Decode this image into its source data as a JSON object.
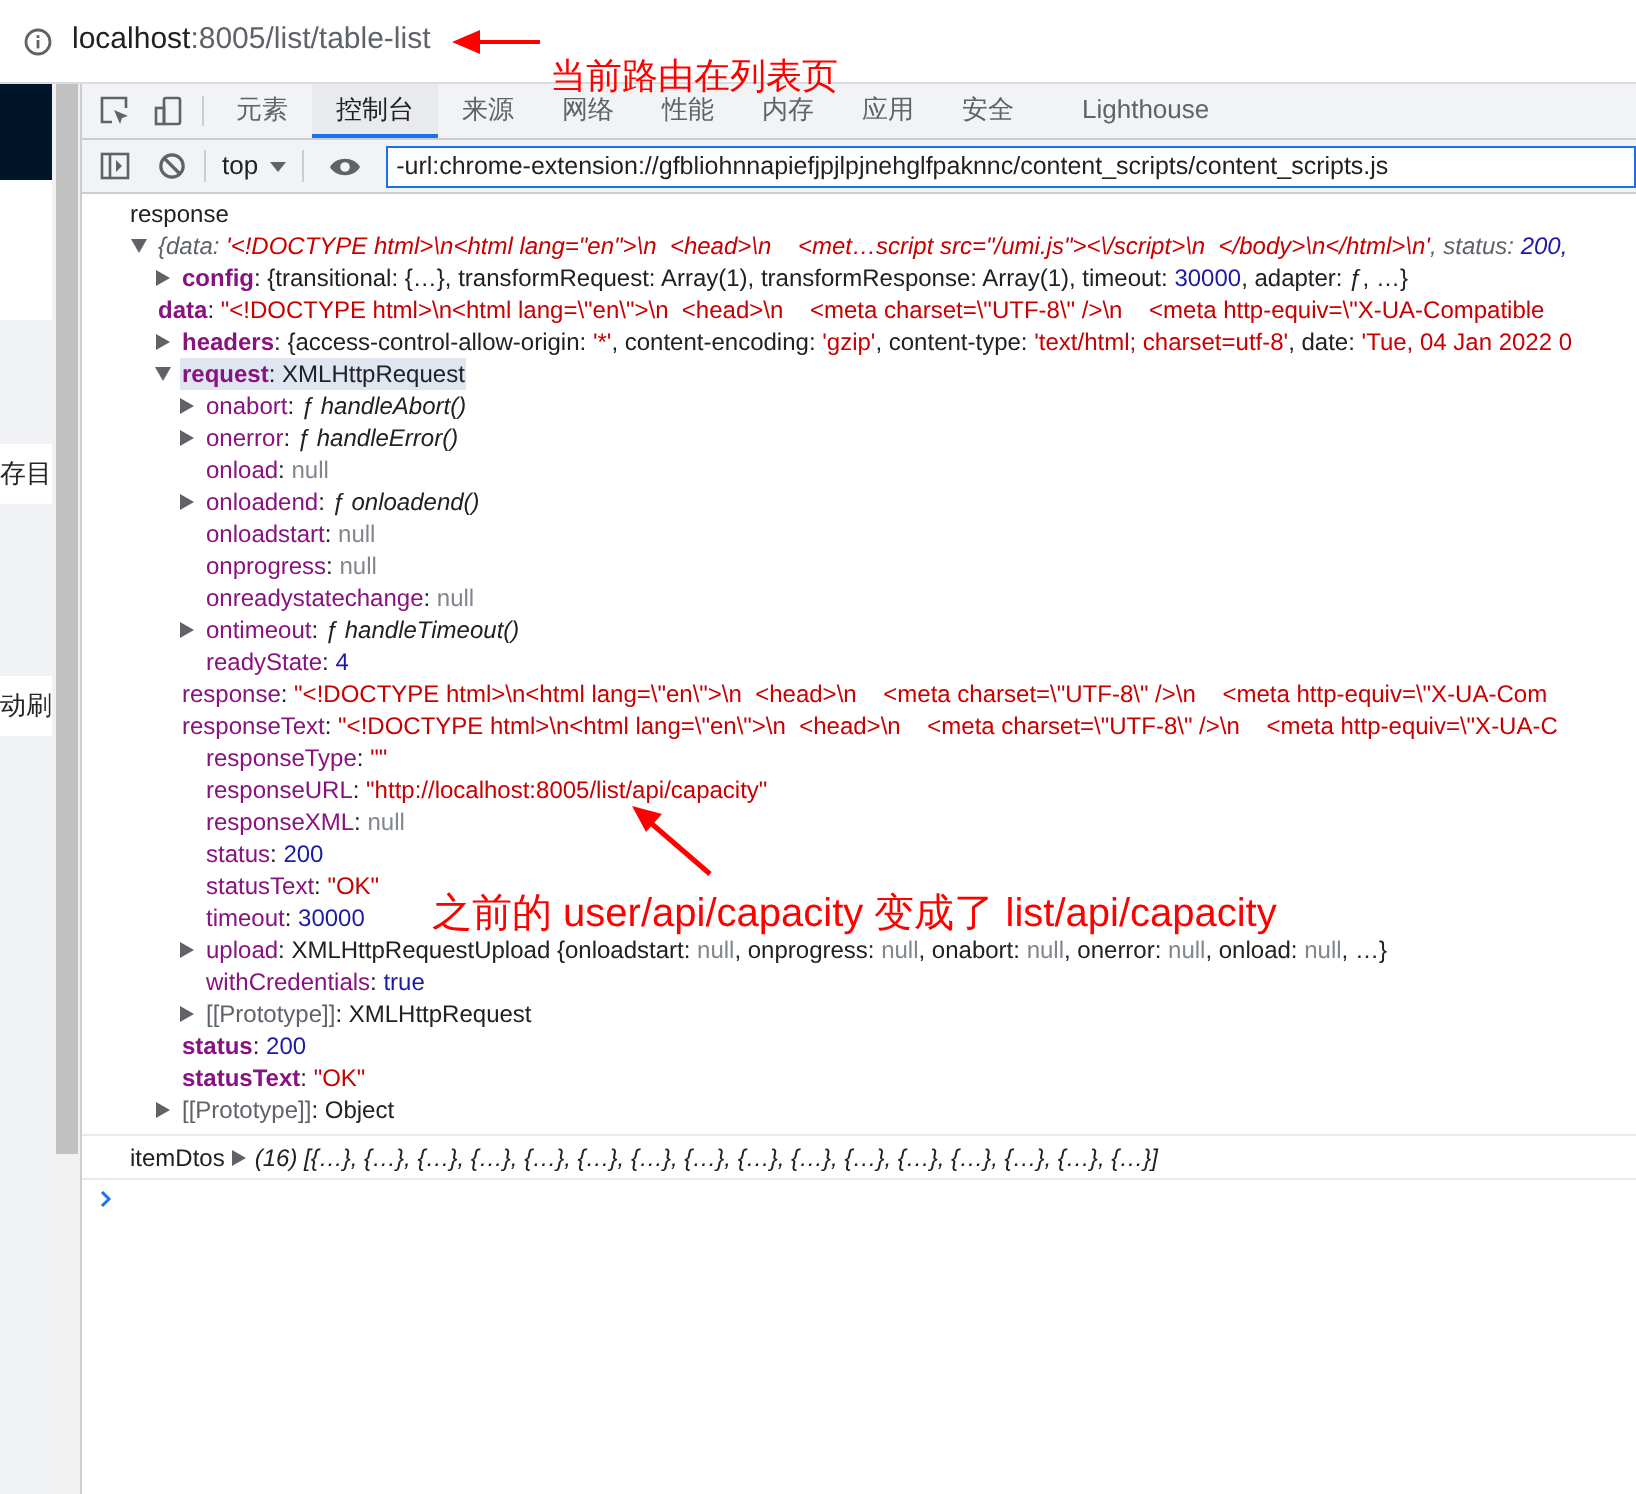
{
  "address_bar": {
    "host": "localhost",
    "path": ":8005/list/table-list"
  },
  "annotations": [
    {
      "kind": "url",
      "text": "当前路由在列表页"
    },
    {
      "kind": "response_url",
      "text": "之前的 user/api/capacity 变成了 list/api/capacity"
    }
  ],
  "page_strip": {
    "buttons": [
      "存目",
      "动刷"
    ]
  },
  "devtools": {
    "tabs": [
      {
        "label": "元素",
        "selected": false
      },
      {
        "label": "控制台",
        "selected": true
      },
      {
        "label": "来源",
        "selected": false
      },
      {
        "label": "网络",
        "selected": false
      },
      {
        "label": "性能",
        "selected": false
      },
      {
        "label": "内存",
        "selected": false
      },
      {
        "label": "应用",
        "selected": false
      },
      {
        "label": "安全",
        "selected": false
      },
      {
        "label": "Lighthouse",
        "selected": false
      }
    ],
    "context": "top",
    "filter": "-url:chrome-extension://gfbliohnnapiefjpjlpjnehglfpaknnc/content_scripts/content_scripts.js"
  },
  "console": {
    "label": "response",
    "separator": ": ",
    "root": {
      "kind": "expandable",
      "expanded": true,
      "italic": true,
      "selected": false,
      "value": [
        {
          "kind": "dim",
          "text": "{data: "
        },
        {
          "kind": "str",
          "text": "'<!DOCTYPE html>\\n<html lang=\"en\">\\n  <head>\\n    <met…script src=\"/umi.js\"><\\/script>\\n  </body>\\n</html>\\n'"
        },
        {
          "kind": "dim",
          "text": ", status: "
        },
        {
          "kind": "num",
          "text": "200,"
        }
      ],
      "children": [
        {
          "key": "config",
          "kind": "expandable",
          "expanded": false,
          "bold": true,
          "selected": false,
          "value": [
            {
              "kind": "text",
              "text": "{transitional: {…}, transformRequest: Array(1), transformResponse: Array(1), timeout: "
            },
            {
              "kind": "num",
              "text": "30000"
            },
            {
              "kind": "text",
              "text": ", adapter: ƒ, …}"
            }
          ]
        },
        {
          "key": "data",
          "kind": "flat",
          "bold": true,
          "selected": false,
          "value": [
            {
              "kind": "str",
              "text": "\"<!DOCTYPE html>\\n<html lang=\\\"en\\\">\\n  <head>\\n    <meta charset=\\\"UTF-8\\\" />\\n    <meta http-equiv=\\\"X-UA-Compatible"
            }
          ]
        },
        {
          "key": "headers",
          "kind": "expandable",
          "expanded": false,
          "bold": true,
          "selected": false,
          "value": [
            {
              "kind": "text",
              "text": "{access-control-allow-origin: "
            },
            {
              "kind": "str",
              "text": "'*'"
            },
            {
              "kind": "text",
              "text": ", content-encoding: "
            },
            {
              "kind": "str",
              "text": "'gzip'"
            },
            {
              "kind": "text",
              "text": ", content-type: "
            },
            {
              "kind": "str",
              "text": "'text/html; charset=utf-8'"
            },
            {
              "kind": "text",
              "text": ", date: "
            },
            {
              "kind": "str",
              "text": "'Tue, 04 Jan 2022 0"
            }
          ]
        },
        {
          "key": "request",
          "kind": "expandable",
          "expanded": true,
          "bold": true,
          "selected": true,
          "value": [
            {
              "kind": "text",
              "text": "XMLHttpRequest"
            }
          ],
          "children": [
            {
              "key": "onabort",
              "kind": "expandable",
              "expanded": false,
              "bold": false,
              "selected": false,
              "value": [
                {
                  "kind": "func",
                  "text": "ƒ handleAbort()"
                }
              ]
            },
            {
              "key": "onerror",
              "kind": "expandable",
              "expanded": false,
              "bold": false,
              "selected": false,
              "value": [
                {
                  "kind": "func",
                  "text": "ƒ handleError()"
                }
              ]
            },
            {
              "key": "onload",
              "kind": "leaf",
              "bold": false,
              "selected": false,
              "value": [
                {
                  "kind": "null",
                  "text": "null"
                }
              ]
            },
            {
              "key": "onloadend",
              "kind": "expandable",
              "expanded": false,
              "bold": false,
              "selected": false,
              "value": [
                {
                  "kind": "func",
                  "text": "ƒ onloadend()"
                }
              ]
            },
            {
              "key": "onloadstart",
              "kind": "leaf",
              "bold": false,
              "selected": false,
              "value": [
                {
                  "kind": "null",
                  "text": "null"
                }
              ]
            },
            {
              "key": "onprogress",
              "kind": "leaf",
              "bold": false,
              "selected": false,
              "value": [
                {
                  "kind": "null",
                  "text": "null"
                }
              ]
            },
            {
              "key": "onreadystatechange",
              "kind": "leaf",
              "bold": false,
              "selected": false,
              "value": [
                {
                  "kind": "null",
                  "text": "null"
                }
              ]
            },
            {
              "key": "ontimeout",
              "kind": "expandable",
              "expanded": false,
              "bold": false,
              "selected": false,
              "value": [
                {
                  "kind": "func",
                  "text": "ƒ handleTimeout()"
                }
              ]
            },
            {
              "key": "readyState",
              "kind": "leaf",
              "bold": false,
              "selected": false,
              "value": [
                {
                  "kind": "num",
                  "text": "4"
                }
              ]
            },
            {
              "key": "response",
              "kind": "flat",
              "bold": false,
              "selected": false,
              "value": [
                {
                  "kind": "str",
                  "text": "\"<!DOCTYPE html>\\n<html lang=\\\"en\\\">\\n  <head>\\n    <meta charset=\\\"UTF-8\\\" />\\n    <meta http-equiv=\\\"X-UA-Com"
                }
              ]
            },
            {
              "key": "responseText",
              "kind": "flat",
              "bold": false,
              "selected": false,
              "value": [
                {
                  "kind": "str",
                  "text": "\"<!DOCTYPE html>\\n<html lang=\\\"en\\\">\\n  <head>\\n    <meta charset=\\\"UTF-8\\\" />\\n    <meta http-equiv=\\\"X-UA-C"
                }
              ]
            },
            {
              "key": "responseType",
              "kind": "leaf",
              "bold": false,
              "selected": false,
              "value": [
                {
                  "kind": "str",
                  "text": "\"\""
                }
              ]
            },
            {
              "key": "responseURL",
              "kind": "leaf",
              "bold": false,
              "selected": false,
              "value": [
                {
                  "kind": "str",
                  "text": "\"http://localhost:8005/list/api/capacity\""
                }
              ]
            },
            {
              "key": "responseXML",
              "kind": "leaf",
              "bold": false,
              "selected": false,
              "value": [
                {
                  "kind": "null",
                  "text": "null"
                }
              ]
            },
            {
              "key": "status",
              "kind": "leaf",
              "bold": false,
              "selected": false,
              "value": [
                {
                  "kind": "num",
                  "text": "200"
                }
              ]
            },
            {
              "key": "statusText",
              "kind": "leaf",
              "bold": false,
              "selected": false,
              "value": [
                {
                  "kind": "str",
                  "text": "\"OK\""
                }
              ]
            },
            {
              "key": "timeout",
              "kind": "leaf",
              "bold": false,
              "selected": false,
              "value": [
                {
                  "kind": "num",
                  "text": "30000"
                }
              ]
            },
            {
              "key": "upload",
              "kind": "expandable",
              "expanded": false,
              "bold": false,
              "selected": false,
              "value": [
                {
                  "kind": "text",
                  "text": "XMLHttpRequestUpload {onloadstart: "
                },
                {
                  "kind": "null",
                  "text": "null"
                },
                {
                  "kind": "text",
                  "text": ", onprogress: "
                },
                {
                  "kind": "null",
                  "text": "null"
                },
                {
                  "kind": "text",
                  "text": ", onabort: "
                },
                {
                  "kind": "null",
                  "text": "null"
                },
                {
                  "kind": "text",
                  "text": ", onerror: "
                },
                {
                  "kind": "null",
                  "text": "null"
                },
                {
                  "kind": "text",
                  "text": ", onload: "
                },
                {
                  "kind": "null",
                  "text": "null"
                },
                {
                  "kind": "text",
                  "text": ", …}"
                }
              ]
            },
            {
              "key": "withCredentials",
              "kind": "leaf",
              "bold": false,
              "selected": false,
              "value": [
                {
                  "kind": "num",
                  "text": "true"
                }
              ]
            },
            {
              "key": "[[Prototype]]",
              "internal": true,
              "kind": "expandable",
              "expanded": false,
              "bold": false,
              "selected": false,
              "value": [
                {
                  "kind": "text",
                  "text": "XMLHttpRequest"
                }
              ]
            }
          ]
        },
        {
          "key": "status",
          "kind": "leaf",
          "bold": true,
          "selected": false,
          "value": [
            {
              "kind": "num",
              "text": "200"
            }
          ]
        },
        {
          "key": "statusText",
          "kind": "leaf",
          "bold": true,
          "selected": false,
          "value": [
            {
              "kind": "str",
              "text": "\"OK\""
            }
          ]
        },
        {
          "key": "[[Prototype]]",
          "internal": true,
          "kind": "expandable",
          "expanded": false,
          "bold": false,
          "selected": false,
          "value": [
            {
              "kind": "text",
              "text": "Object"
            }
          ]
        }
      ]
    },
    "array_entry": {
      "label": "itemDtos",
      "expanded": false,
      "count": "(16)",
      "preview": "[{…}, {…}, {…}, {…}, {…}, {…}, {…}, {…}, {…}, {…}, {…}, {…}, {…}, {…}, {…}, {…}]"
    }
  }
}
